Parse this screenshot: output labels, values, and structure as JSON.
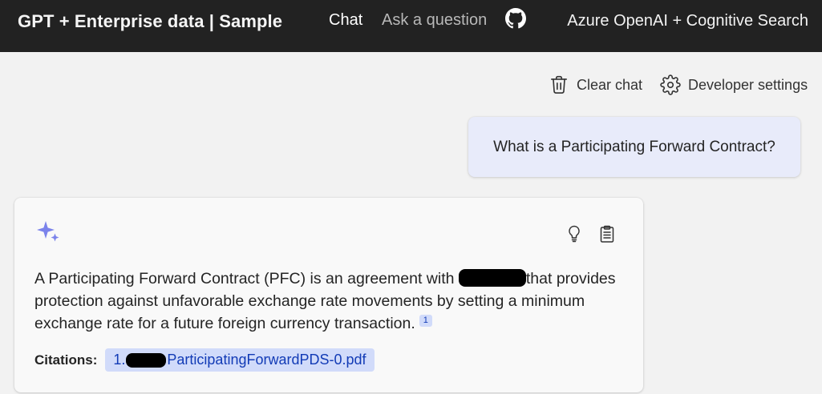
{
  "header": {
    "brand": "GPT + Enterprise data | Sample",
    "nav": {
      "chat": "Chat",
      "ask": "Ask a question"
    },
    "right_title": "Azure OpenAI + Cognitive Search"
  },
  "commands": {
    "clear_chat": "Clear chat",
    "developer_settings": "Developer settings"
  },
  "user_message": "What is a Participating Forward Contract?",
  "answer": {
    "text_before_redaction": "A Participating Forward Contract (PFC) is an agreement with ",
    "text_after_redaction": "that provides protection against unfavorable exchange rate movements by setting a minimum exchange rate for a future foreign currency transaction.",
    "citation_marker": "1",
    "citations_label": "Citations:",
    "citation": {
      "prefix": "1.",
      "filename": "ParticipatingForwardPDS-0.pdf"
    }
  },
  "colors": {
    "header_bg": "#222222",
    "page_bg": "#f2f2f2",
    "user_bubble": "#e8ebfa",
    "citation_bg": "#d1dbfa",
    "citation_text": "#123bb6",
    "sparkle": "#7b83eb"
  },
  "icons": {
    "github": "github-icon",
    "clear": "trash-icon",
    "settings": "gear-icon",
    "sparkle": "sparkle-icon",
    "thought": "lightbulb-icon",
    "supporting": "clipboard-icon"
  }
}
